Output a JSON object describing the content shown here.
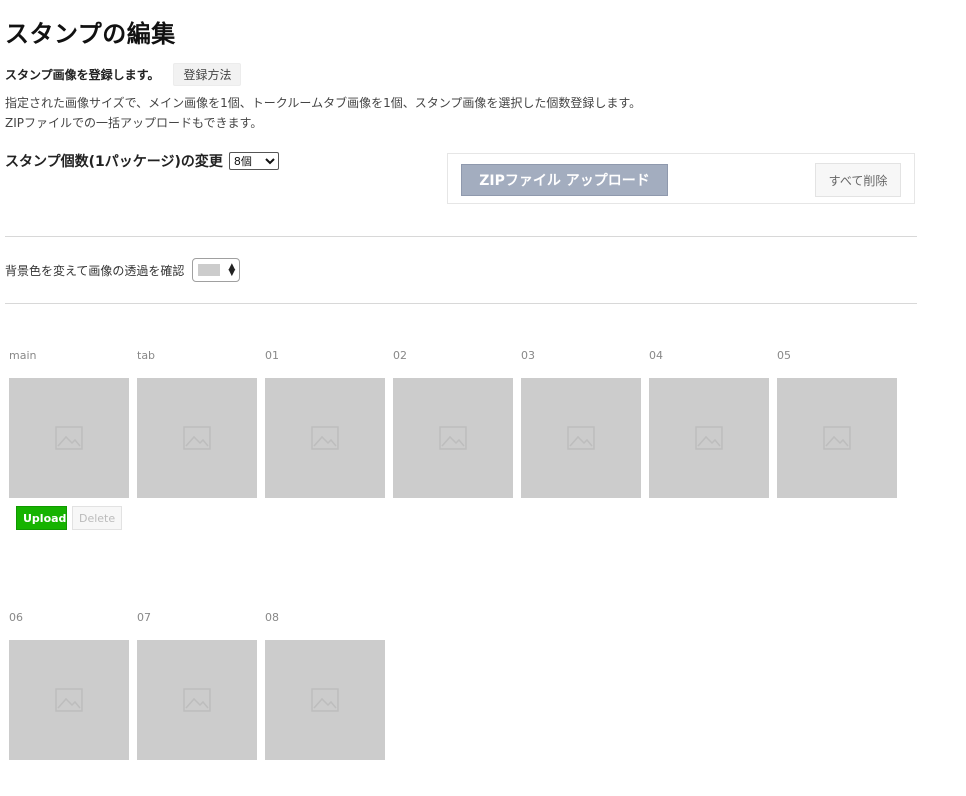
{
  "page": {
    "title": "スタンプの編集"
  },
  "intro": {
    "text": "スタンプ画像を登録します。",
    "howto_label": "登録方法"
  },
  "description": {
    "line1": "指定された画像サイズで、メイン画像を1個、トークルームタブ画像を1個、スタンプ画像を選択した個数登録します。",
    "line2": "ZIPファイルでの一括アップロードもできます。"
  },
  "count": {
    "label": "スタンプ個数(1パッケージ)の変更",
    "selected": "8個"
  },
  "upload_panel": {
    "zip_label": "ZIPファイル アップロード",
    "delete_all_label": "すべて削除"
  },
  "background": {
    "label": "背景色を変えて画像の透過を確認",
    "swatch_color": "#cccccc"
  },
  "stamps": {
    "row1": [
      {
        "label": "main"
      },
      {
        "label": "tab"
      },
      {
        "label": "01"
      },
      {
        "label": "02"
      },
      {
        "label": "03"
      },
      {
        "label": "04"
      },
      {
        "label": "05"
      }
    ],
    "row2": [
      {
        "label": "06"
      },
      {
        "label": "07"
      },
      {
        "label": "08"
      }
    ]
  },
  "actions": {
    "upload_label": "Upload",
    "delete_label": "Delete"
  },
  "icons": {
    "placeholder": "image-placeholder-icon"
  },
  "colors": {
    "upload_green": "#16b300",
    "zip_button": "#a3adbf",
    "thumb_bg": "#cccccc"
  }
}
